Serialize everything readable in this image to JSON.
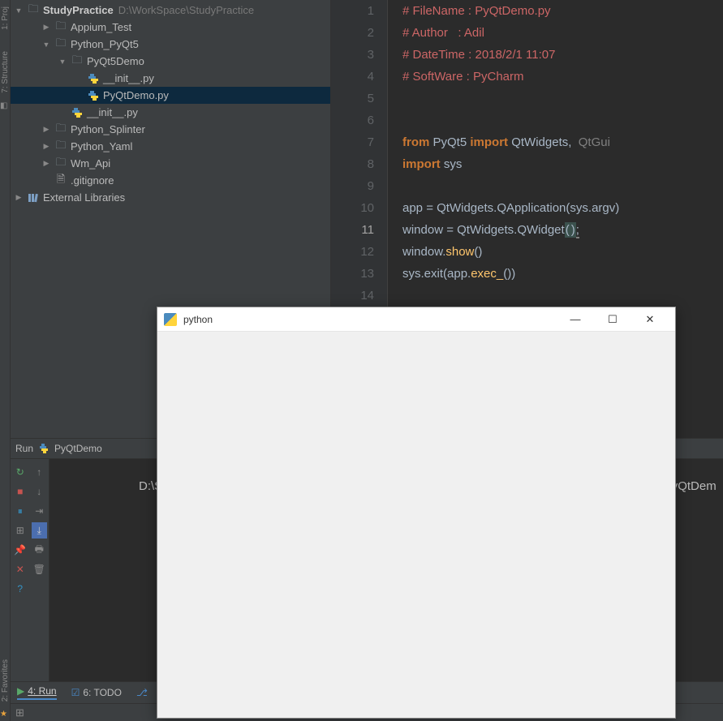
{
  "left_gutter": {
    "project_label": "1: Proj",
    "structure_label": "7: Structure",
    "favorites_label": "2: Favorites"
  },
  "tree": {
    "root_name": "StudyPractice",
    "root_path": "D:\\WorkSpace\\StudyPractice",
    "items": [
      {
        "label": "Appium_Test",
        "indent": 1,
        "arrow": "right",
        "icon": "folder"
      },
      {
        "label": "Python_PyQt5",
        "indent": 1,
        "arrow": "down",
        "icon": "folder"
      },
      {
        "label": "PyQt5Demo",
        "indent": 2,
        "arrow": "down",
        "icon": "folder"
      },
      {
        "label": "__init__.py",
        "indent": 3,
        "arrow": "",
        "icon": "py"
      },
      {
        "label": "PyQtDemo.py",
        "indent": 3,
        "arrow": "",
        "icon": "py",
        "selected": true
      },
      {
        "label": "__init__.py",
        "indent": 2,
        "arrow": "",
        "icon": "py"
      },
      {
        "label": "Python_Splinter",
        "indent": 1,
        "arrow": "right",
        "icon": "folder"
      },
      {
        "label": "Python_Yaml",
        "indent": 1,
        "arrow": "right",
        "icon": "folder"
      },
      {
        "label": "Wm_Api",
        "indent": 1,
        "arrow": "right",
        "icon": "folder"
      },
      {
        "label": ".gitignore",
        "indent": 1,
        "arrow": "",
        "icon": "file"
      }
    ],
    "external_libs": "External Libraries"
  },
  "code": {
    "lines": [
      [
        {
          "t": "# FileName : PyQtDemo.py",
          "c": "red"
        }
      ],
      [
        {
          "t": "# Author   : Adil",
          "c": "red"
        }
      ],
      [
        {
          "t": "# DateTime : 2018/2/1 11:07",
          "c": "red"
        }
      ],
      [
        {
          "t": "# SoftWare : PyCharm",
          "c": "red"
        }
      ],
      [],
      [],
      [
        {
          "t": "from",
          "c": "kw"
        },
        {
          "t": " PyQt5 ",
          "c": "id"
        },
        {
          "t": "import",
          "c": "kw"
        },
        {
          "t": " QtWidgets",
          "c": "id"
        },
        {
          "t": ",",
          "c": "p"
        },
        {
          "t": "  QtGui",
          "c": "dim"
        }
      ],
      [
        {
          "t": "import",
          "c": "kw"
        },
        {
          "t": " sys",
          "c": "id"
        }
      ],
      [],
      [
        {
          "t": "app ",
          "c": "id"
        },
        {
          "t": "=",
          "c": "p"
        },
        {
          "t": " QtWidgets",
          "c": "id"
        },
        {
          "t": ".",
          "c": "p"
        },
        {
          "t": "QApplication",
          "c": "id"
        },
        {
          "t": "(",
          "c": "p"
        },
        {
          "t": "sys",
          "c": "id"
        },
        {
          "t": ".",
          "c": "p"
        },
        {
          "t": "argv",
          "c": "id"
        },
        {
          "t": ")",
          "c": "p"
        }
      ],
      [
        {
          "t": "window ",
          "c": "id"
        },
        {
          "t": "=",
          "c": "p"
        },
        {
          "t": " QtWidgets",
          "c": "id"
        },
        {
          "t": ".",
          "c": "p"
        },
        {
          "t": "QWidget",
          "c": "id"
        },
        {
          "t": "(",
          "c": "phl"
        },
        {
          "t": ")",
          "c": "phl"
        },
        {
          "t": ";",
          "c": "cursor"
        }
      ],
      [
        {
          "t": "window",
          "c": "id"
        },
        {
          "t": ".",
          "c": "p"
        },
        {
          "t": "show",
          "c": "func"
        },
        {
          "t": "()",
          "c": "p"
        }
      ],
      [
        {
          "t": "sys",
          "c": "id"
        },
        {
          "t": ".",
          "c": "p"
        },
        {
          "t": "exit",
          "c": "id"
        },
        {
          "t": "(",
          "c": "p"
        },
        {
          "t": "app",
          "c": "id"
        },
        {
          "t": ".",
          "c": "p"
        },
        {
          "t": "exec_",
          "c": "func"
        },
        {
          "t": "()",
          "c": "p"
        },
        {
          "t": ")",
          "c": "p"
        }
      ],
      []
    ]
  },
  "run": {
    "header_label": "Run",
    "header_config": "PyQtDemo",
    "output": "D:\\SProgram",
    "output_right": "PyQtDem"
  },
  "bottom": {
    "run": "4: Run",
    "todo": "6: TODO"
  },
  "popup": {
    "title": "python"
  }
}
